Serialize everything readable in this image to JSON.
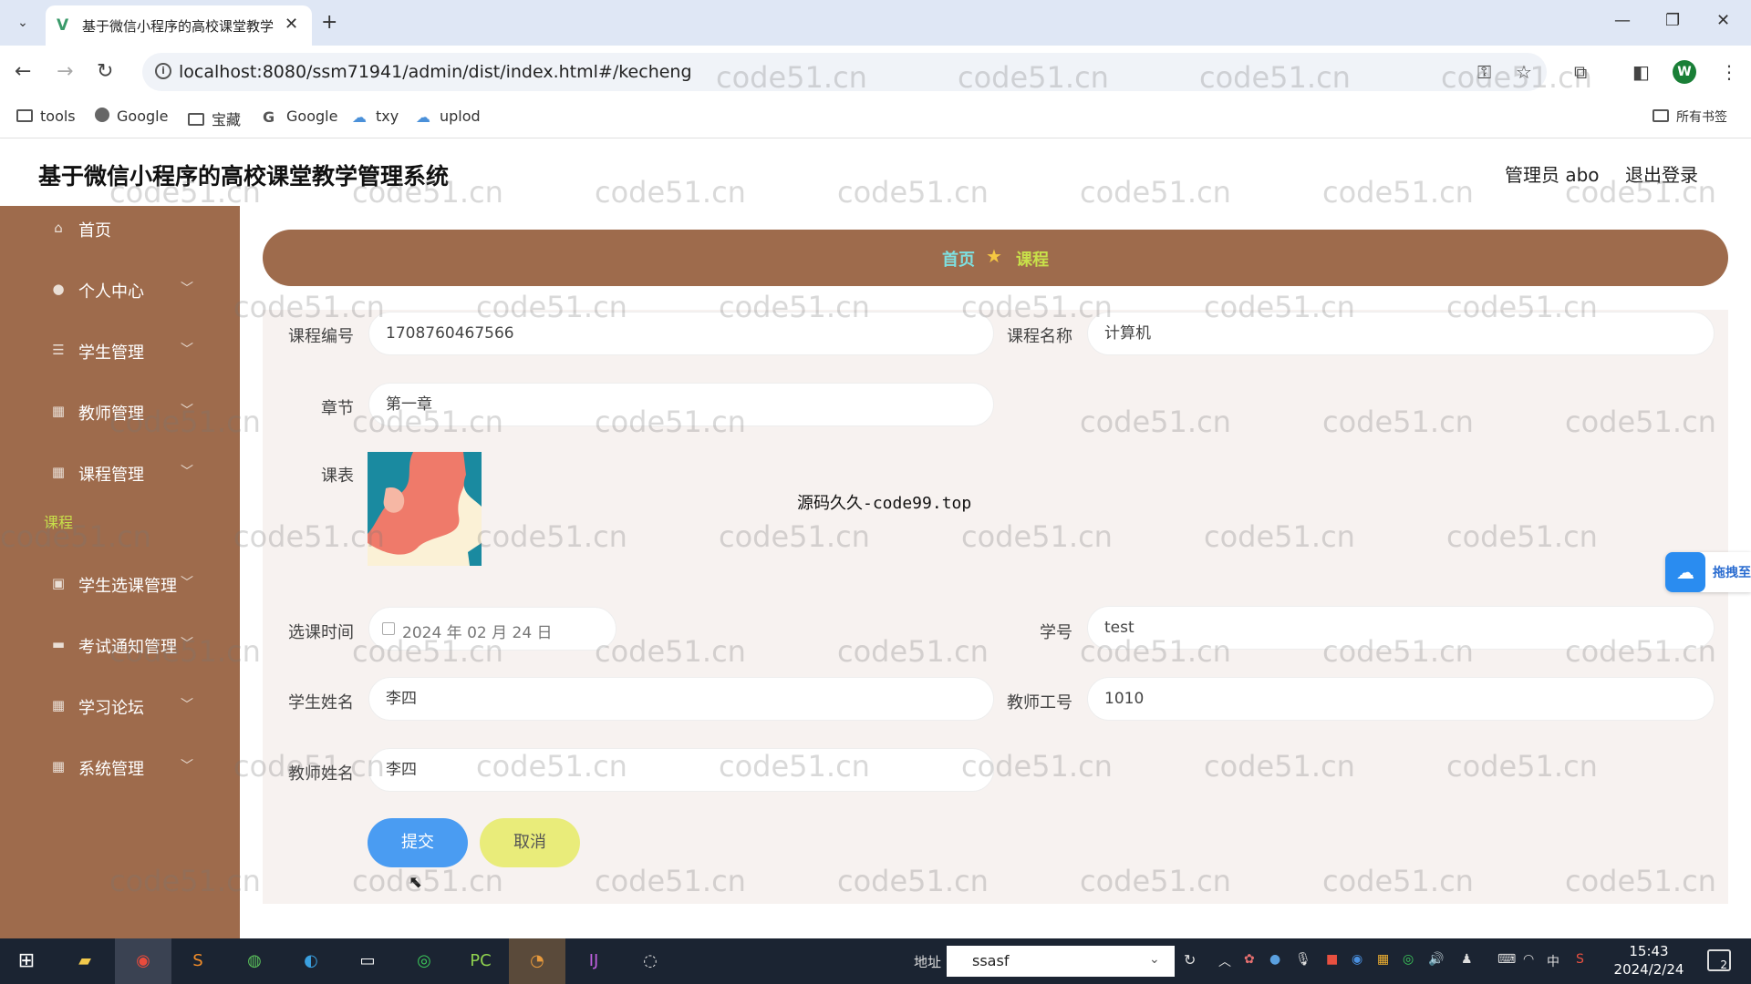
{
  "browser": {
    "tab_title": "基于微信小程序的高校课堂教学",
    "url": "localhost:8080/ssm71941/admin/dist/index.html#/kecheng",
    "bookmarks": [
      "tools",
      "Google",
      "宝藏",
      "Google",
      "txy",
      "uplod"
    ],
    "all_bookmarks": "所有书签"
  },
  "app": {
    "title": "基于微信小程序的高校课堂教学管理系统",
    "admin_label": "管理员 abo",
    "logout_label": "退出登录"
  },
  "sidebar": {
    "items": [
      {
        "label": "首页",
        "icon": "home-icon"
      },
      {
        "label": "个人中心",
        "icon": "user-icon"
      },
      {
        "label": "学生管理",
        "icon": "list-icon"
      },
      {
        "label": "教师管理",
        "icon": "grid-icon"
      },
      {
        "label": "课程管理",
        "icon": "grid-icon"
      },
      {
        "label": "学生选课管理",
        "icon": "image-icon"
      },
      {
        "label": "考试通知管理",
        "icon": "notice-icon"
      },
      {
        "label": "学习论坛",
        "icon": "grid-icon"
      },
      {
        "label": "系统管理",
        "icon": "grid-icon"
      }
    ],
    "sub_active": "课程"
  },
  "breadcrumb": {
    "home": "首页",
    "current": "课程"
  },
  "form": {
    "course_no_label": "课程编号",
    "course_no": "1708760467566",
    "course_name_label": "课程名称",
    "course_name": "计算机",
    "chapter_label": "章节",
    "chapter": "第一章",
    "schedule_label": "课表",
    "select_time_label": "选课时间",
    "select_time": "2024 年 02 月 24 日",
    "student_no_label": "学号",
    "student_no": "test",
    "student_name_label": "学生姓名",
    "student_name": "李四",
    "teacher_no_label": "教师工号",
    "teacher_no": "1010",
    "teacher_name_label": "教师姓名",
    "teacher_name": "李四",
    "submit": "提交",
    "cancel": "取消"
  },
  "overlay_text": "源码久久-code99.top",
  "watermark": "code51.cn",
  "float_button": "拖拽至",
  "taskbar": {
    "address_label": "地址",
    "address_value": "ssasf",
    "time": "15:43",
    "date": "2024/2/24",
    "ime": "中",
    "notifications": "2"
  },
  "colors": {
    "sidebar": "#9e6b4c",
    "submit": "#4a9cf2",
    "cancel": "#e9ec7a",
    "sub_active": "#c8e04a"
  }
}
